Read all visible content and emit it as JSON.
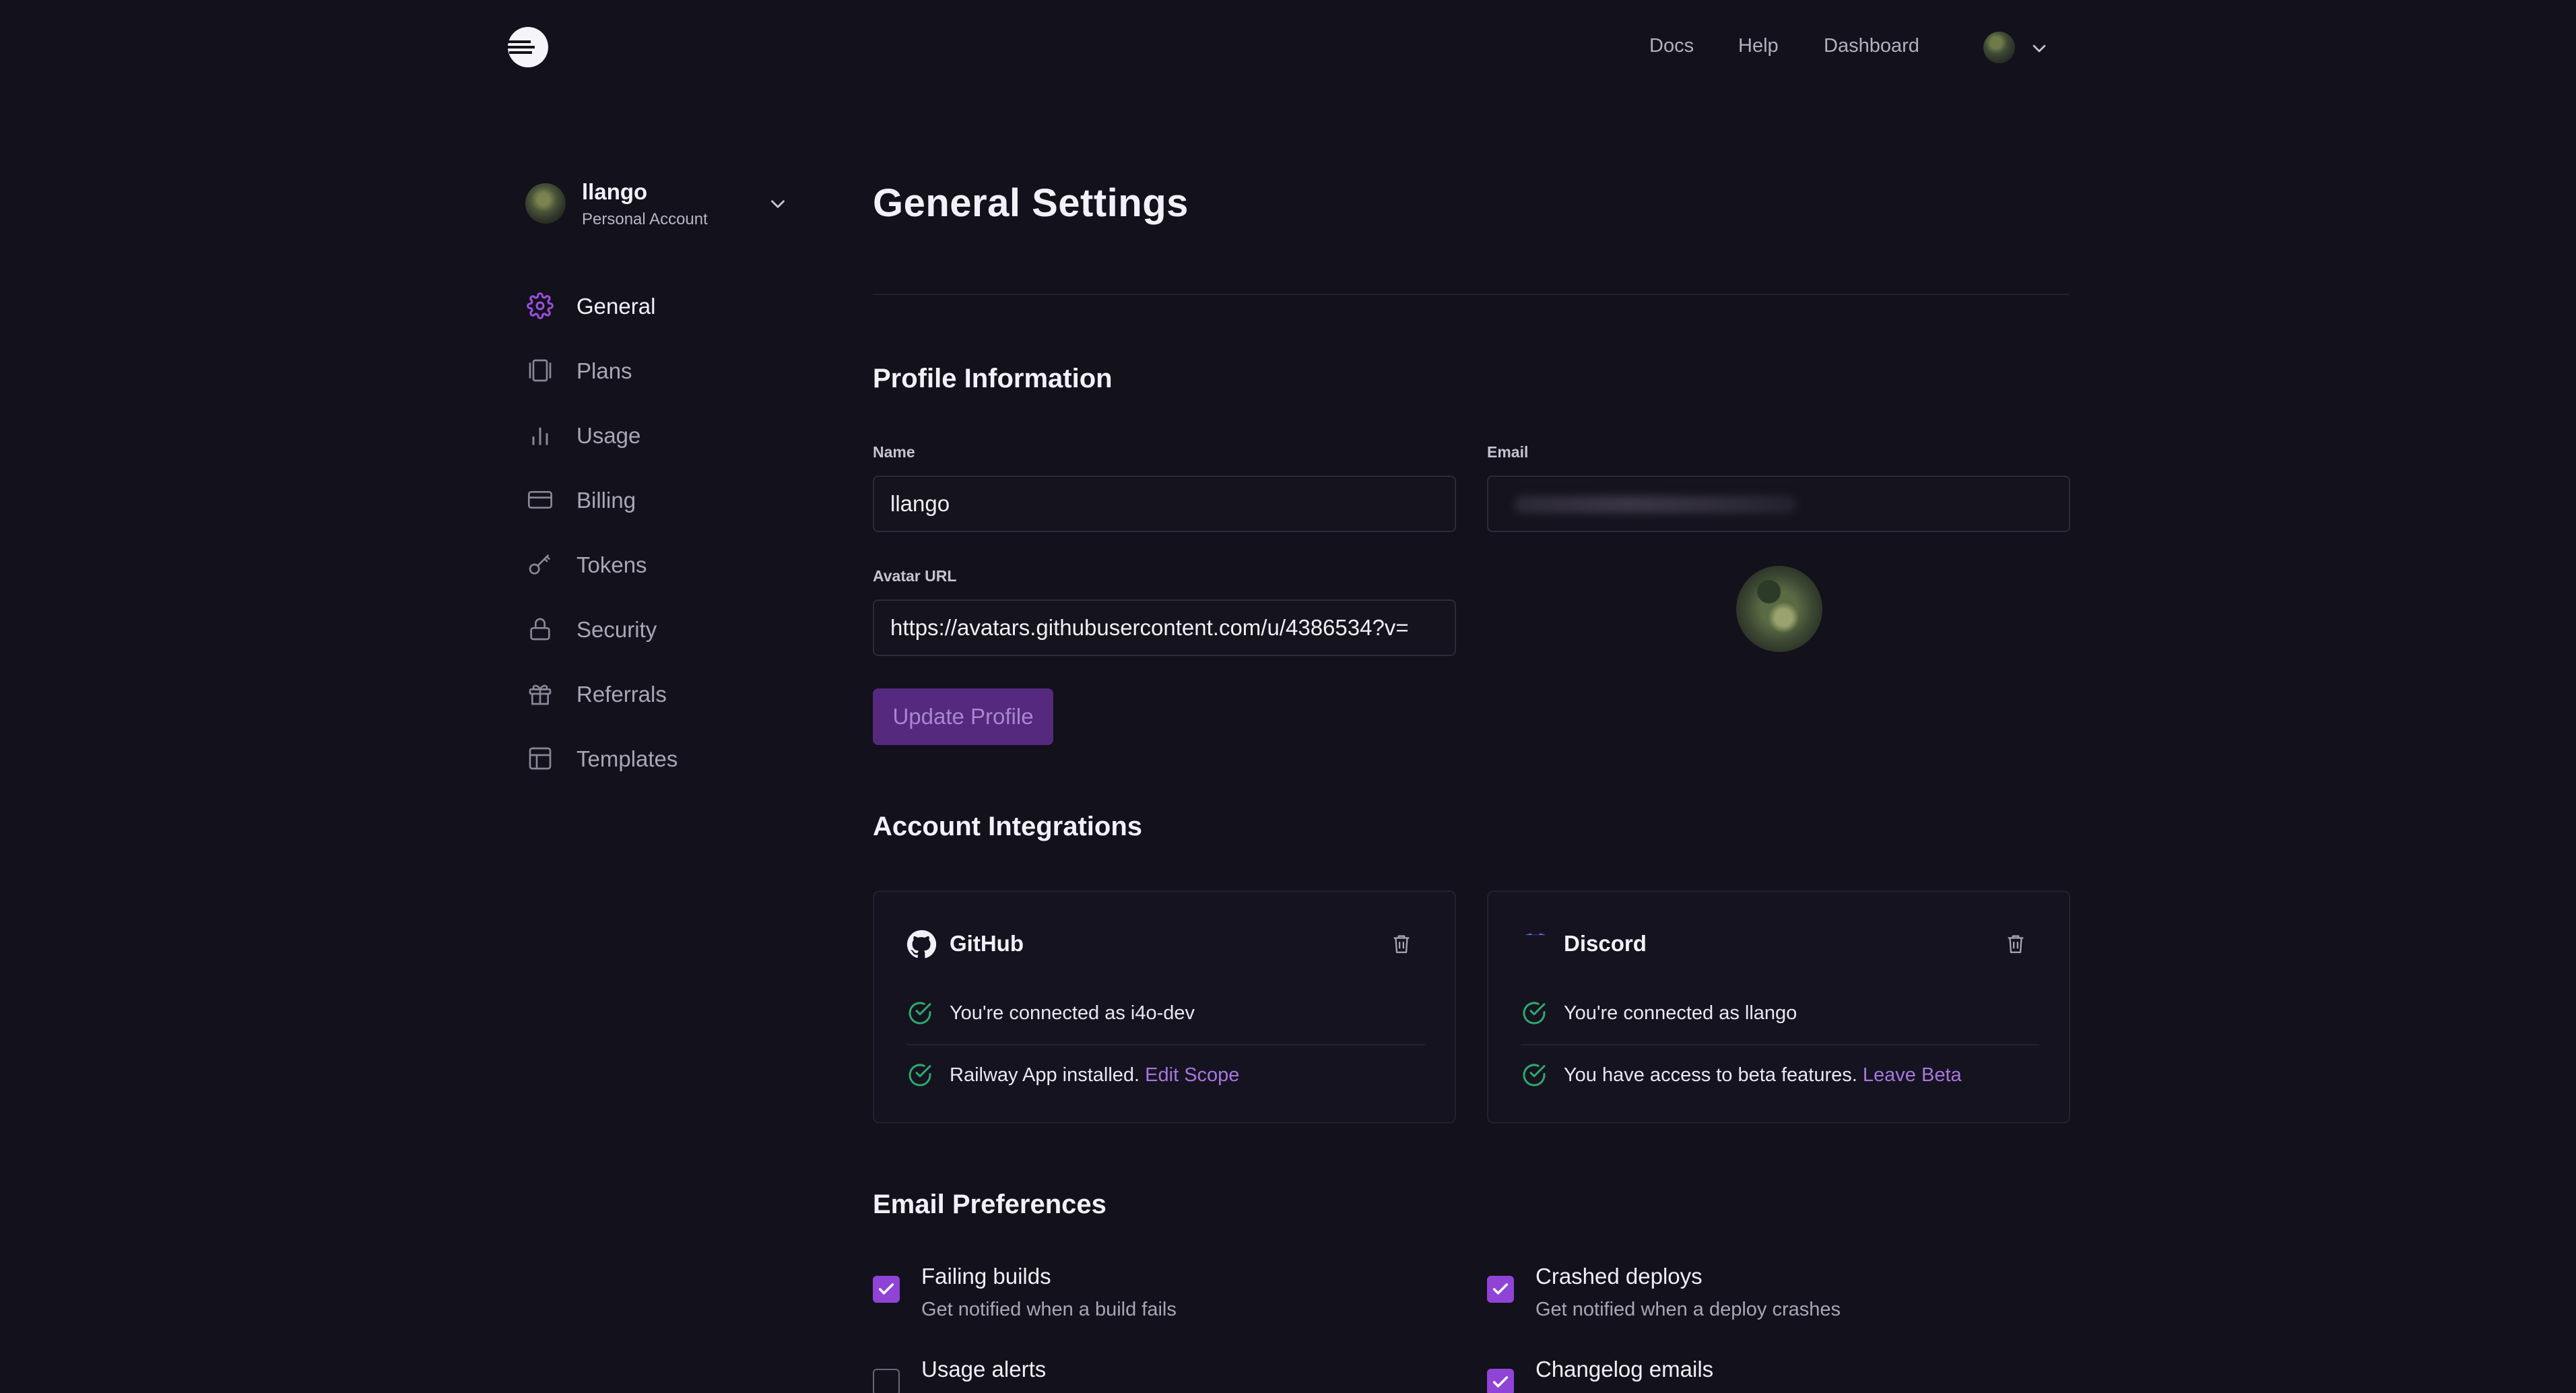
{
  "topnav": {
    "links": [
      "Docs",
      "Help",
      "Dashboard"
    ]
  },
  "account": {
    "name": "llango",
    "type": "Personal Account"
  },
  "sidebar": {
    "items": [
      {
        "label": "General",
        "icon": "gear-icon",
        "active": true
      },
      {
        "label": "Plans",
        "icon": "plans-icon",
        "active": false
      },
      {
        "label": "Usage",
        "icon": "bar-chart-icon",
        "active": false
      },
      {
        "label": "Billing",
        "icon": "credit-card-icon",
        "active": false
      },
      {
        "label": "Tokens",
        "icon": "key-icon",
        "active": false
      },
      {
        "label": "Security",
        "icon": "lock-icon",
        "active": false
      },
      {
        "label": "Referrals",
        "icon": "gift-icon",
        "active": false
      },
      {
        "label": "Templates",
        "icon": "template-icon",
        "active": false
      }
    ]
  },
  "main": {
    "title": "General Settings",
    "profile": {
      "heading": "Profile Information",
      "name_label": "Name",
      "name_value": "llango",
      "email_label": "Email",
      "email_value": "",
      "avatar_label": "Avatar URL",
      "avatar_value": "https://avatars.githubusercontent.com/u/4386534?v=",
      "update_button": "Update Profile"
    },
    "integrations": {
      "heading": "Account Integrations",
      "github": {
        "name": "GitHub",
        "connected": "You're connected as i4o-dev",
        "app_text": "Railway App installed.",
        "app_link": "Edit Scope"
      },
      "discord": {
        "name": "Discord",
        "connected": "You're connected as llango",
        "beta_text": "You have access to beta features.",
        "beta_link": "Leave Beta"
      }
    },
    "email_prefs": {
      "heading": "Email Preferences",
      "items": [
        {
          "title": "Failing builds",
          "desc": "Get notified when a build fails",
          "checked": true
        },
        {
          "title": "Crashed deploys",
          "desc": "Get notified when a deploy crashes",
          "checked": true
        },
        {
          "title": "Usage alerts",
          "desc": "",
          "checked": false
        },
        {
          "title": "Changelog emails",
          "desc": "",
          "checked": true
        }
      ]
    }
  },
  "colors": {
    "background": "#13111c",
    "accent": "#8f44d6",
    "link": "#a776e0",
    "success": "#2fa86c",
    "button": "#54297e"
  }
}
